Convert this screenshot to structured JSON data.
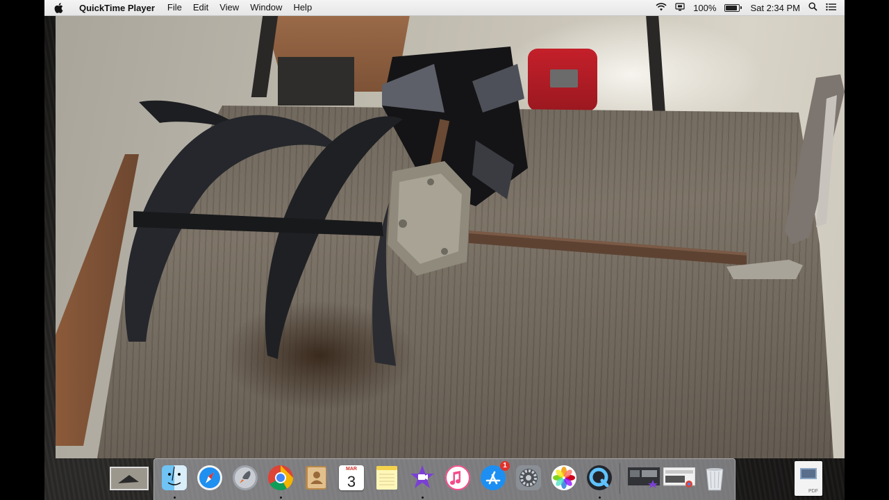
{
  "menubar": {
    "app_name": "QuickTime Player",
    "menus": [
      "File",
      "Edit",
      "View",
      "Window",
      "Help"
    ],
    "battery_percent": "100%",
    "clock": "Sat 2:34 PM",
    "battery_level": 1.0
  },
  "video": {
    "content": "tiller auger attachment on workbench"
  },
  "dock": {
    "apps": [
      {
        "name": "Finder",
        "icon": "finder-icon",
        "running": true
      },
      {
        "name": "Safari",
        "icon": "safari-icon",
        "running": false
      },
      {
        "name": "Launchpad",
        "icon": "launchpad-icon",
        "running": false
      },
      {
        "name": "Chrome",
        "icon": "chrome-icon",
        "running": true
      },
      {
        "name": "Contacts",
        "icon": "contacts-icon",
        "running": false
      },
      {
        "name": "Calendar",
        "icon": "calendar-icon",
        "running": false,
        "month": "MAR",
        "day": "3"
      },
      {
        "name": "Notes",
        "icon": "notes-icon",
        "running": false
      },
      {
        "name": "iMovie",
        "icon": "imovie-icon",
        "running": true
      },
      {
        "name": "iTunes",
        "icon": "itunes-icon",
        "running": false
      },
      {
        "name": "App Store",
        "icon": "app-store-icon",
        "running": false,
        "badge": "1"
      },
      {
        "name": "System Preferences",
        "icon": "system-preferences-icon",
        "running": false
      },
      {
        "name": "Photos",
        "icon": "photos-icon",
        "running": false
      },
      {
        "name": "QuickTime Player",
        "icon": "quicktime-icon",
        "running": true
      }
    ],
    "pdf_label": "PDF"
  },
  "colors": {
    "menubar_bg": "#ececec",
    "dock_bg": "#c8c8cd",
    "badge": "#e0332b",
    "tank_red": "#c4202a"
  }
}
